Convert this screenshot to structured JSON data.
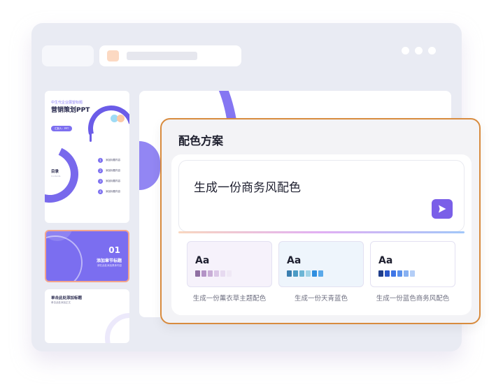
{
  "slides": {
    "s1": {
      "kicker": "中生代企业展望标题",
      "title": "营销策划PPT",
      "pill": "汇报人：PPT",
      "catalog": "目录",
      "catalog_sub": "Contents",
      "items": [
        "添加标题内容",
        "添加标题内容",
        "添加标题内容",
        "添加标题内容"
      ]
    },
    "s2": {
      "number": "01",
      "heading": "添加章节标题",
      "sub": "请在此处添加具体内容"
    },
    "s3": {
      "heading": "单击此处添加标题",
      "sub": "单击此处添加正文"
    }
  },
  "dialog": {
    "title": "配色方案",
    "prompt": "生成一份商务风配色",
    "send_icon": "send-arrow-icon"
  },
  "palettes": [
    {
      "aa": "Aa",
      "label": "生成一份薰衣草主题配色",
      "bg": "#f6f2fb",
      "colors": [
        "#8f6fa2",
        "#b393c6",
        "#c8add6",
        "#dac6e6",
        "#e7daf0",
        "#efe8f5"
      ]
    },
    {
      "aa": "Aa",
      "label": "生成一份天青蓝色",
      "bg": "#eef5fc",
      "colors": [
        "#3b7fb0",
        "#4b9bc5",
        "#6db6d6",
        "#a0d3e7",
        "#2f8fe0",
        "#5aa9ea"
      ]
    },
    {
      "aa": "Aa",
      "label": "生成一份蓝色商务风配色",
      "bg": "#ffffff",
      "colors": [
        "#1f3d8a",
        "#2b57c9",
        "#3f76e6",
        "#5b91ec",
        "#88b1f2",
        "#b4cef7"
      ]
    }
  ],
  "colors": {
    "accent": "#7a5fe8",
    "dialog_border": "#d88b3e"
  }
}
